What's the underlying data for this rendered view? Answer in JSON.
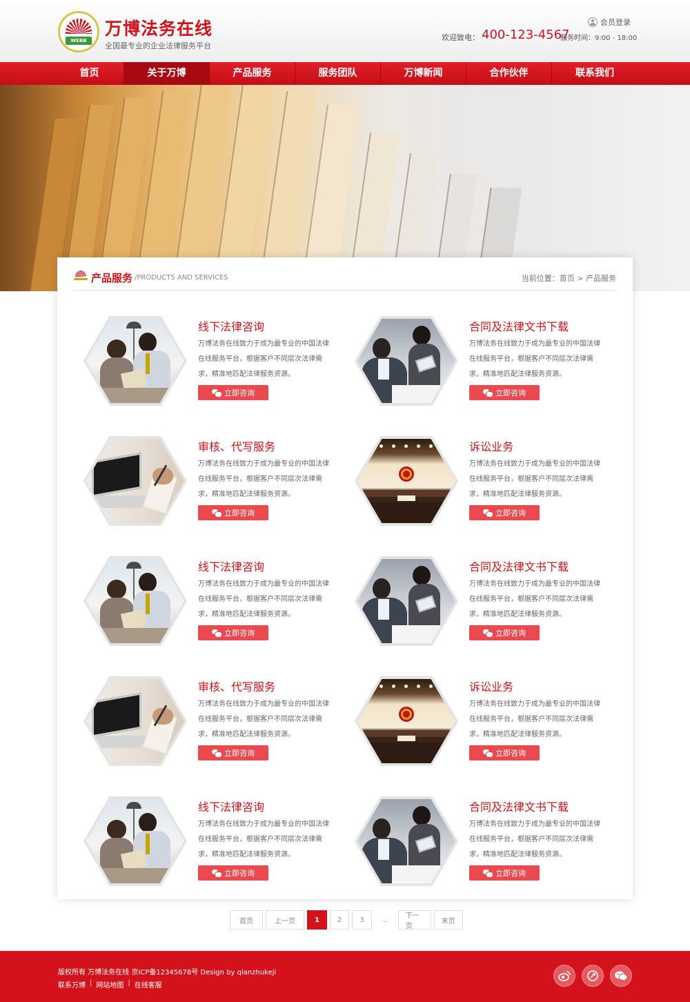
{
  "header": {
    "logo_text": "WEBB",
    "brand_name": "万博法务在线",
    "slogan": "全国最专业的企业法律服务平台",
    "member_login": "会员登录",
    "hotline_label": "欢迎致电：",
    "hotline_number": "400-123-4567",
    "hours": "服务时间：9:00 - 18:00"
  },
  "nav": {
    "items": [
      {
        "label": "首页"
      },
      {
        "label": "关于万博"
      },
      {
        "label": "产品服务"
      },
      {
        "label": "服务团队"
      },
      {
        "label": "万博新闻"
      },
      {
        "label": "合作伙伴"
      },
      {
        "label": "联系我们"
      }
    ],
    "active_index": 1
  },
  "section": {
    "title": "产品服务",
    "subtitle": "/PRODUCTS AND SERVICES",
    "breadcrumb": "当前位置：首页 > 产品服务"
  },
  "products": [
    {
      "title": "线下法律咨询",
      "desc": "万博法务在线致力于成为最专业的中国法律在线服务平台，根据客户不同层次法律需求，精准地匹配法律服务资源。",
      "button": "立即咨询",
      "image": "office-consult-photo"
    },
    {
      "title": "合同及法律文书下载",
      "desc": "万博法务在线致力于成为最专业的中国法律在线服务平台，根据客户不同层次法律需求，精准地匹配法律服务资源。",
      "button": "立即咨询",
      "image": "executive-tablet-photo"
    },
    {
      "title": "审核、代写服务",
      "desc": "万博法务在线致力于成为最专业的中国法律在线服务平台，根据客户不同层次法律需求，精准地匹配法律服务资源。",
      "button": "立即咨询",
      "image": "laptop-writing-photo"
    },
    {
      "title": "诉讼业务",
      "desc": "万博法务在线致力于成为最专业的中国法律在线服务平台，根据客户不同层次法律需求，精准地匹配法律服务资源。",
      "button": "立即咨询",
      "image": "courtroom-photo"
    },
    {
      "title": "线下法律咨询",
      "desc": "万博法务在线致力于成为最专业的中国法律在线服务平台，根据客户不同层次法律需求，精准地匹配法律服务资源。",
      "button": "立即咨询",
      "image": "office-consult-photo"
    },
    {
      "title": "合同及法律文书下载",
      "desc": "万博法务在线致力于成为最专业的中国法律在线服务平台，根据客户不同层次法律需求，精准地匹配法律服务资源。",
      "button": "立即咨询",
      "image": "executive-tablet-photo"
    },
    {
      "title": "审核、代写服务",
      "desc": "万博法务在线致力于成为最专业的中国法律在线服务平台，根据客户不同层次法律需求，精准地匹配法律服务资源。",
      "button": "立即咨询",
      "image": "laptop-writing-photo"
    },
    {
      "title": "诉讼业务",
      "desc": "万博法务在线致力于成为最专业的中国法律在线服务平台，根据客户不同层次法律需求，精准地匹配法律服务资源。",
      "button": "立即咨询",
      "image": "courtroom-photo"
    },
    {
      "title": "线下法律咨询",
      "desc": "万博法务在线致力于成为最专业的中国法律在线服务平台，根据客户不同层次法律需求，精准地匹配法律服务资源。",
      "button": "立即咨询",
      "image": "office-consult-photo"
    },
    {
      "title": "合同及法律文书下载",
      "desc": "万博法务在线致力于成为最专业的中国法律在线服务平台，根据客户不同层次法律需求，精准地匹配法律服务资源。",
      "button": "立即咨询",
      "image": "executive-tablet-photo"
    }
  ],
  "pagination": {
    "first": "首页",
    "prev": "上一页",
    "pages": [
      "1",
      "2",
      "3"
    ],
    "current": "1",
    "ellipsis": "...",
    "next": "下一页",
    "last": "末页"
  },
  "footer": {
    "copyright": "版权所有  万博法务在线  京ICP备12345678号  Design by qianzhukeji",
    "links": [
      "联系万博",
      "网站地图",
      "在线客服"
    ],
    "social_icons": [
      "weibo-icon",
      "qq-icon",
      "wechat-icon"
    ]
  },
  "colors": {
    "brand_red": "#d3121c",
    "button_red": "#ea4a4f",
    "nav_active": "#a80a12"
  }
}
